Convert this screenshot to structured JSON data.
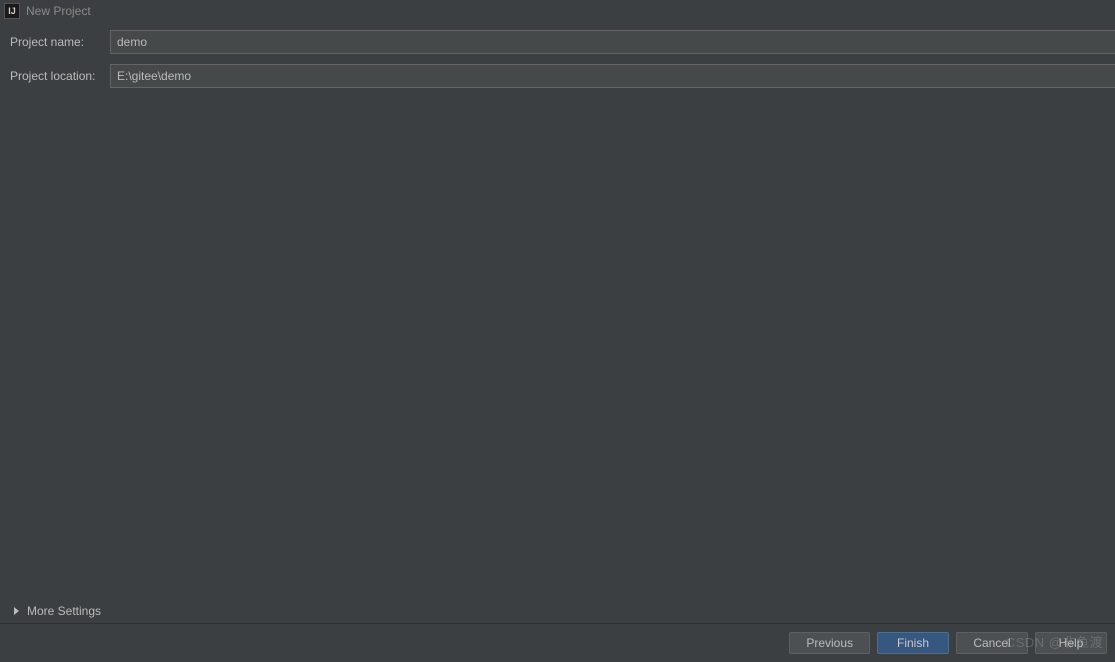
{
  "window": {
    "title": "New Project"
  },
  "form": {
    "project_name_label": "Project name:",
    "project_name_value": "demo",
    "project_location_label": "Project location:",
    "project_location_value": "E:\\gitee\\demo"
  },
  "more_settings_label": "More Settings",
  "buttons": {
    "previous": "Previous",
    "finish": "Finish",
    "cancel": "Cancel",
    "help": "Help"
  },
  "watermark": "CSDN @非鱼渡"
}
